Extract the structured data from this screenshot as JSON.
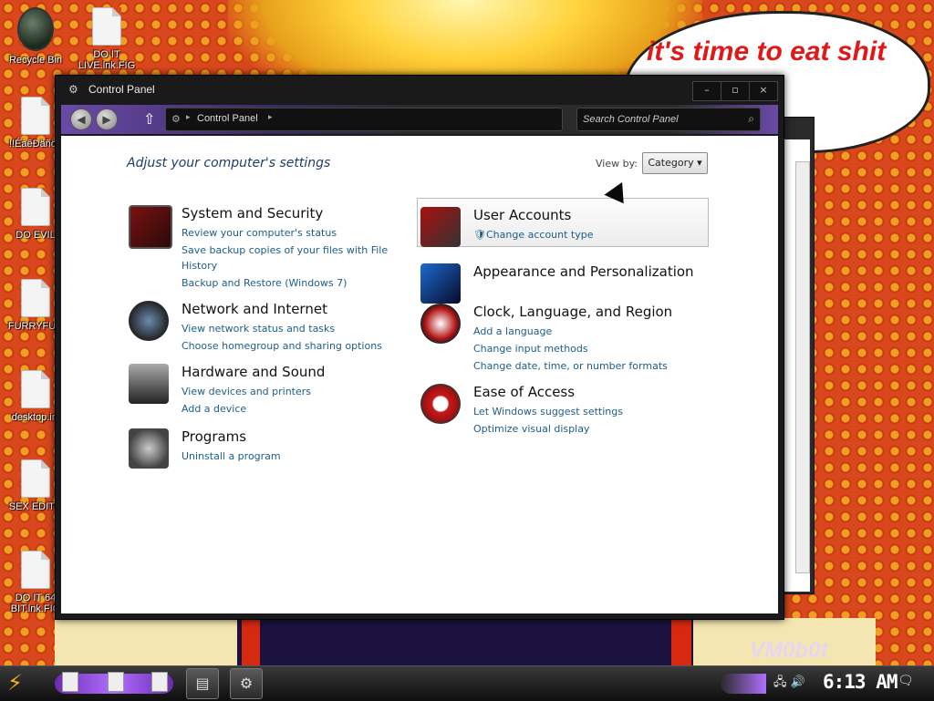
{
  "desktop": {
    "speech_text": "it's time to eat shit and chew",
    "watermark": "VM0b0t",
    "icons": [
      {
        "label": "Recycle Bin",
        "kind": "bin"
      },
      {
        "label": "DO IT LIVE.lnk.FIG",
        "kind": "file"
      },
      {
        "label": "!!ÉàêÐäñöé",
        "kind": "file"
      },
      {
        "label": "DO EVIL",
        "kind": "file"
      },
      {
        "label": "FURRYFUC",
        "kind": "file"
      },
      {
        "label": "desktop.ini",
        "kind": "file"
      },
      {
        "label": "SEX EDITO",
        "kind": "file"
      },
      {
        "label": "DO IT 64 BIT.lnk.FIG",
        "kind": "file"
      }
    ]
  },
  "window": {
    "title": "Control Panel",
    "caption": {
      "minimize": "–",
      "maximize": "▫",
      "close": "×"
    },
    "address_crumb": "Control Panel",
    "search_placeholder": "Search Control Panel",
    "heading": "Adjust your computer's settings",
    "view_by_label": "View by:",
    "view_by_value": "Category ▾",
    "left_categories": [
      {
        "title": "System and Security",
        "icon": "system-security-icon",
        "links": [
          "Review your computer's status",
          "Save backup copies of your files with File",
          "History",
          "Backup and Restore (Windows 7)"
        ]
      },
      {
        "title": "Network and Internet",
        "icon": "network-globe-icon",
        "links": [
          "View network status and tasks",
          "Choose homegroup and sharing options"
        ]
      },
      {
        "title": "Hardware and Sound",
        "icon": "printer-icon",
        "links": [
          "View devices and printers",
          "Add a device"
        ]
      },
      {
        "title": "Programs",
        "icon": "programs-disc-icon",
        "links": [
          "Uninstall a program"
        ]
      }
    ],
    "right_categories": [
      {
        "title": "User Accounts",
        "icon": "user-accounts-icon",
        "links": [
          "Change account type"
        ]
      },
      {
        "title": "Appearance and Personalization",
        "icon": "monitor-icon",
        "links": []
      },
      {
        "title": "Clock, Language, and Region",
        "icon": "clock-icon",
        "links": [
          "Add a language",
          "Change input methods",
          "Change date, time, or number formats"
        ]
      },
      {
        "title": "Ease of Access",
        "icon": "ease-of-access-icon",
        "links": [
          "Let Windows suggest settings",
          "Optimize visual display"
        ]
      }
    ]
  },
  "taskbar": {
    "clock": "6:13 AM",
    "accent": "#b070ff"
  }
}
